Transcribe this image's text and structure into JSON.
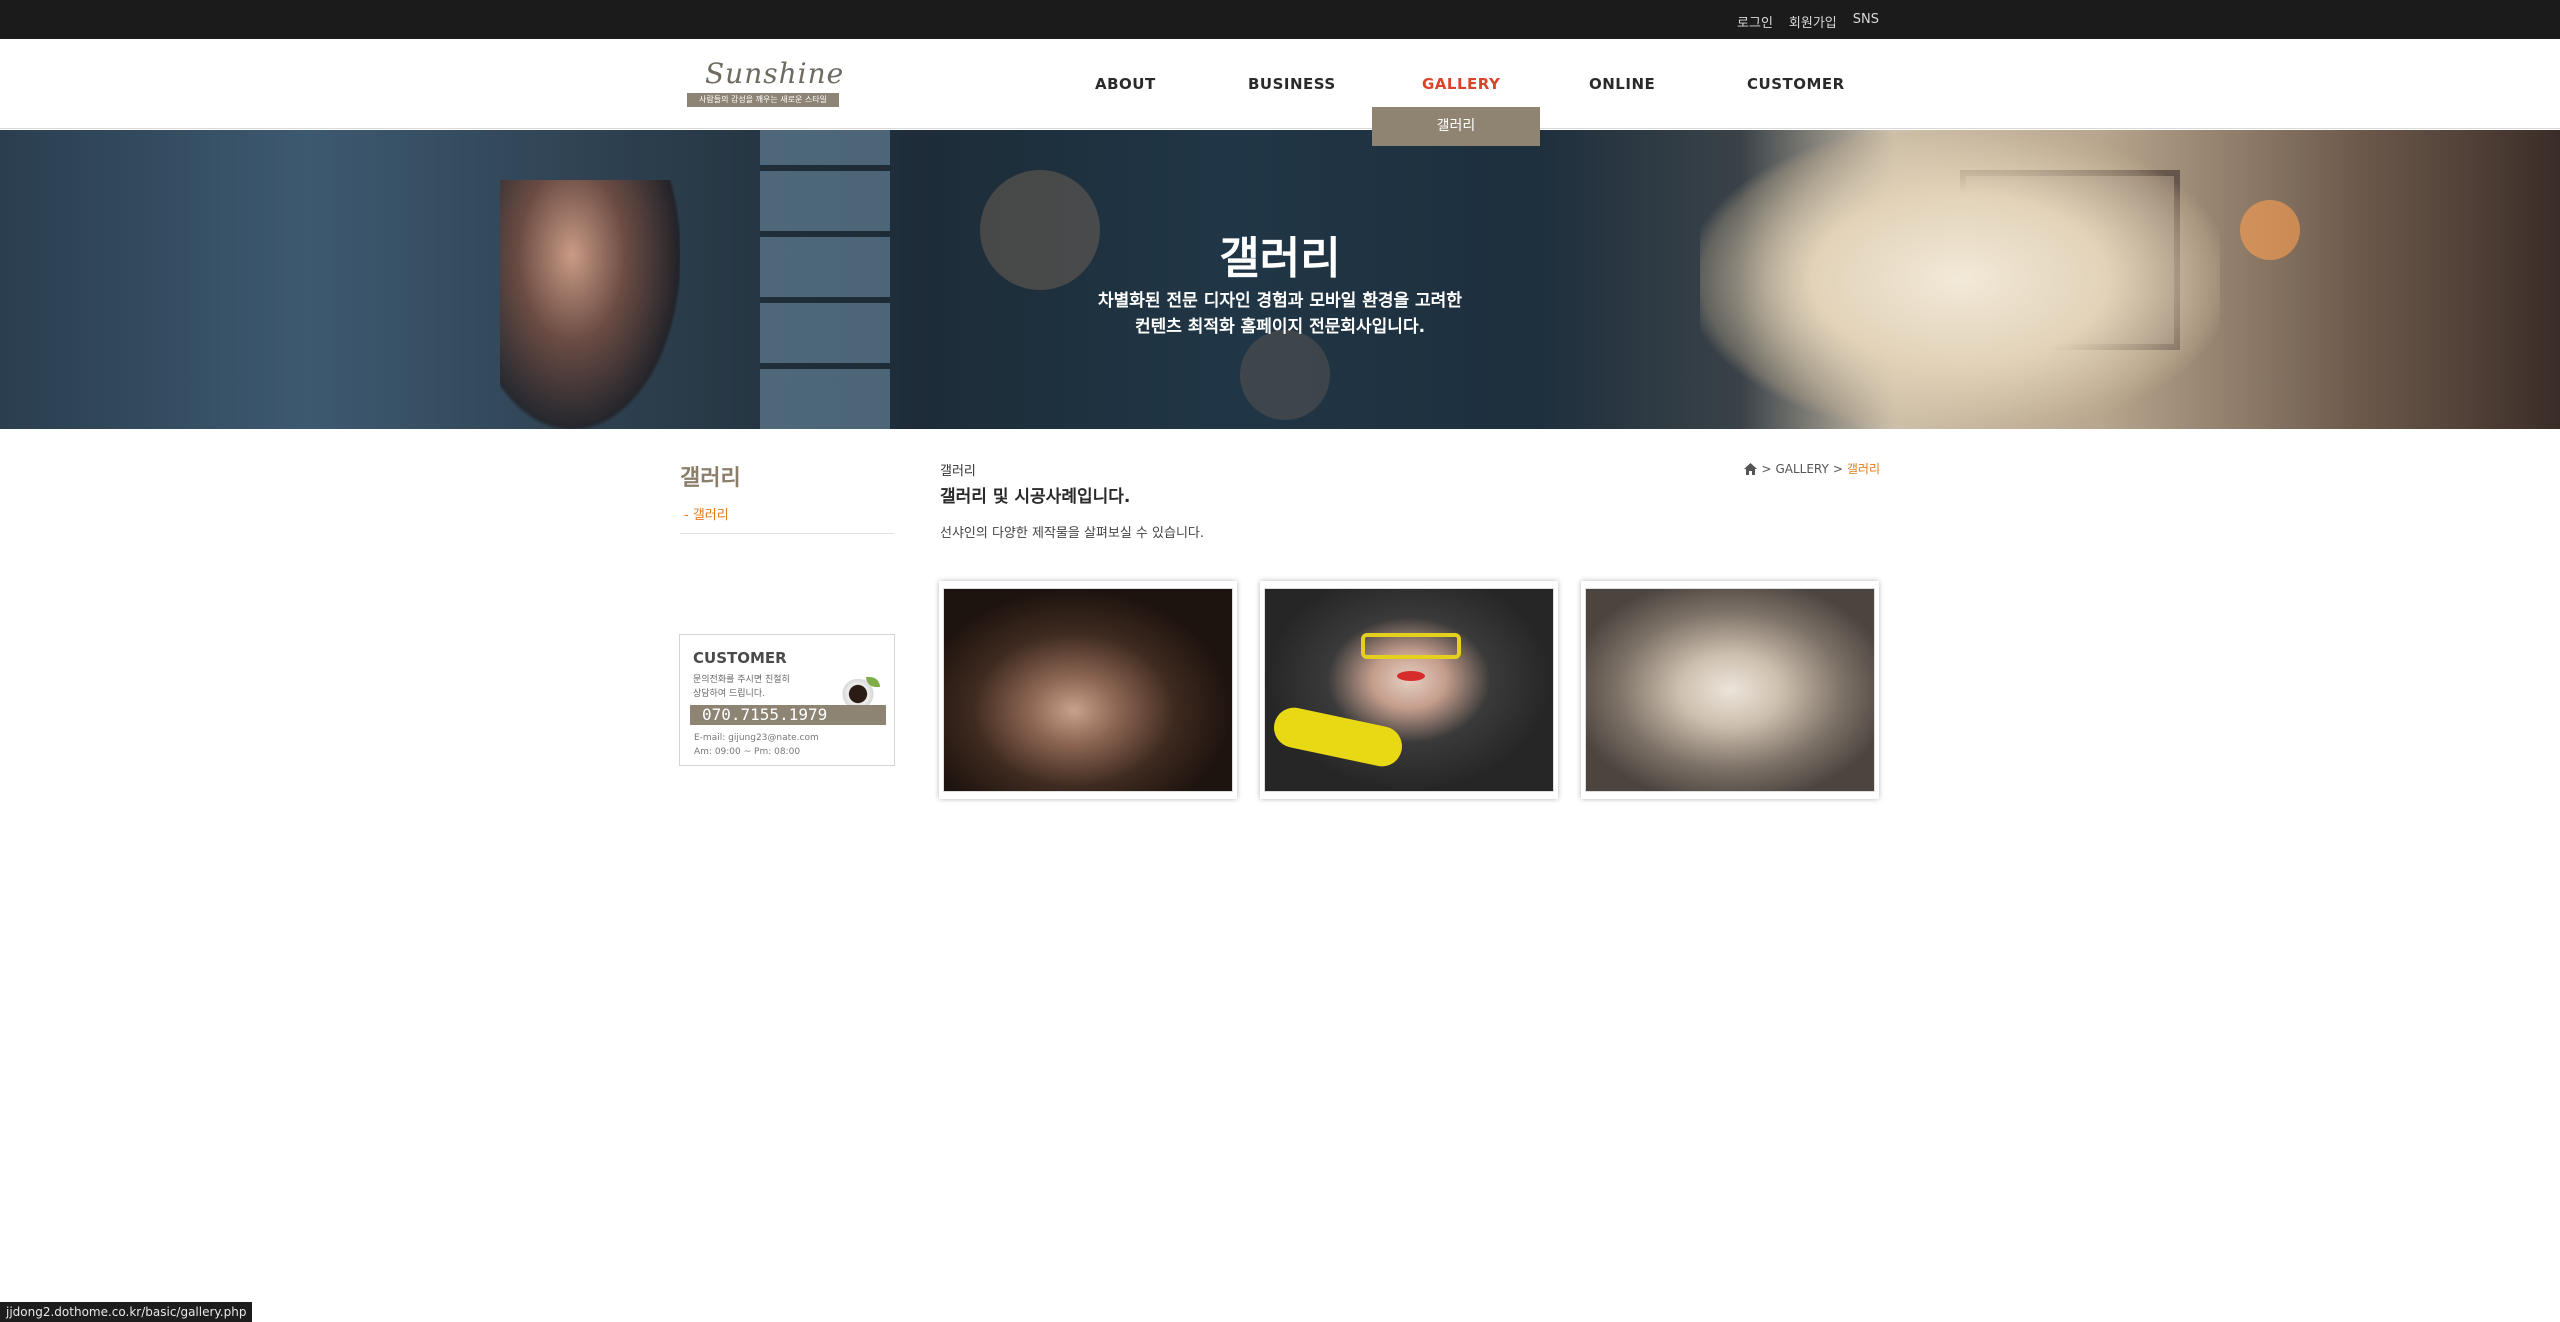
{
  "topbar": {
    "links": [
      "로그인",
      "회원가입",
      "SNS"
    ]
  },
  "logo": {
    "script": "Sunshine",
    "tagline": "사람들의 감성을 깨우는 새로운 스타일"
  },
  "nav": {
    "items": [
      "ABOUT",
      "BUSINESS",
      "GALLERY",
      "ONLINE",
      "CUSTOMER"
    ],
    "active": "GALLERY",
    "submenu_item": "갤러리"
  },
  "hero": {
    "title": "갤러리",
    "line1": "차별화된 전문 디자인 경험과 모바일 환경을 고려한",
    "line2": "컨텐츠 최적화 홈페이지 전문회사입니다."
  },
  "sidebar": {
    "title": "갤러리",
    "item": "- 갤러리",
    "customer": {
      "title": "CUSTOMER",
      "desc1": "문의전화를 주시면 친절히",
      "desc2": "상담하여 드립니다.",
      "phone": "070.7155.1979",
      "email": "E-mail: gijung23@nate.com",
      "hours": "Am: 09:00 ~ Pm: 08:00"
    }
  },
  "content": {
    "small_title": "갤러리",
    "title": "갤러리 및 시공사례입니다.",
    "desc": "선샤인의 다양한 제작물을 살펴보실 수 있습니다.",
    "breadcrumb": {
      "section": "GALLERY",
      "current": "갤러리"
    }
  },
  "status_url": "jjdong2.dothome.co.kr/basic/gallery.php",
  "colors": {
    "accent_orange": "#e07c1c",
    "nav_active": "#d9442b",
    "brand_taupe": "#8f8371"
  }
}
